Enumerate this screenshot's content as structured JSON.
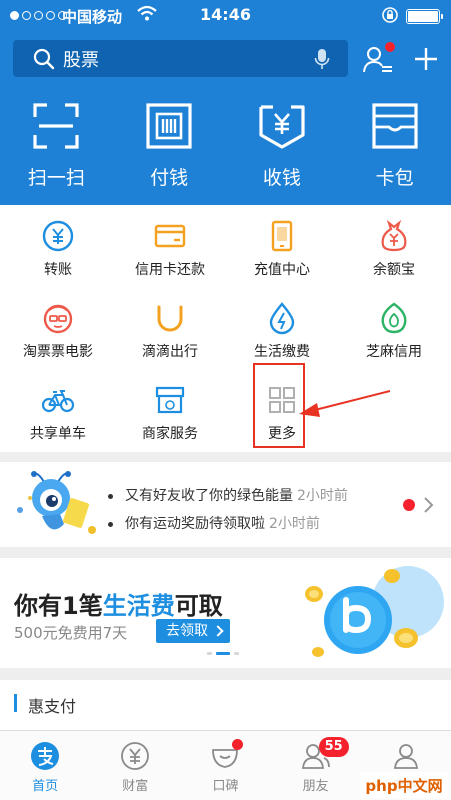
{
  "status_bar": {
    "carrier": "中国移动",
    "time": "14:46"
  },
  "search": {
    "text": "股票"
  },
  "big_tiles": [
    {
      "label": "扫一扫",
      "icon": "scan-icon"
    },
    {
      "label": "付钱",
      "icon": "barcode-pay-icon"
    },
    {
      "label": "收钱",
      "icon": "yuan-receive-icon"
    },
    {
      "label": "卡包",
      "icon": "card-wallet-icon"
    }
  ],
  "services": [
    {
      "label": "转账",
      "icon": "transfer-icon",
      "color": "#1e8fe0"
    },
    {
      "label": "信用卡还款",
      "icon": "credit-card-icon",
      "color": "#f4a020"
    },
    {
      "label": "充值中心",
      "icon": "phone-recharge-icon",
      "color": "#f4a020"
    },
    {
      "label": "余额宝",
      "icon": "money-bag-icon",
      "color": "#ee5a4a"
    },
    {
      "label": "淘票票电影",
      "icon": "movie-mascot-icon",
      "color": "#ee5a4a"
    },
    {
      "label": "滴滴出行",
      "icon": "didi-icon",
      "color": "#f4a020"
    },
    {
      "label": "生活缴费",
      "icon": "utility-drop-icon",
      "color": "#1e8fe0"
    },
    {
      "label": "芝麻信用",
      "icon": "sesame-credit-icon",
      "color": "#2db366"
    },
    {
      "label": "共享单车",
      "icon": "bicycle-icon",
      "color": "#1e8fe0"
    },
    {
      "label": "商家服务",
      "icon": "merchant-icon",
      "color": "#1e8fe0"
    },
    {
      "label": "更多",
      "icon": "grid-more-icon",
      "color": "#b0b0b0"
    }
  ],
  "notices": [
    {
      "text": "又有好友收了你的绿色能量",
      "time": "2小时前"
    },
    {
      "text": "你有运动奖励待领取啦",
      "time": "2小时前"
    }
  ],
  "banner": {
    "title_before": "你有1笔",
    "title_highlight": "生活费",
    "title_after": "可取",
    "subtitle": "500元免费用7天",
    "button": "去领取"
  },
  "section": {
    "title": "惠支付"
  },
  "tabs": [
    {
      "label": "首页",
      "active": true
    },
    {
      "label": "财富",
      "active": false
    },
    {
      "label": "口碑",
      "active": false
    },
    {
      "label": "朋友",
      "active": false,
      "badge": "55"
    },
    {
      "label": "我的",
      "active": false
    }
  ],
  "watermark": "php中文网",
  "colors": {
    "brand_blue": "#1e81d6",
    "accent_blue": "#1e8fe0",
    "alert_red": "#f5222d"
  }
}
